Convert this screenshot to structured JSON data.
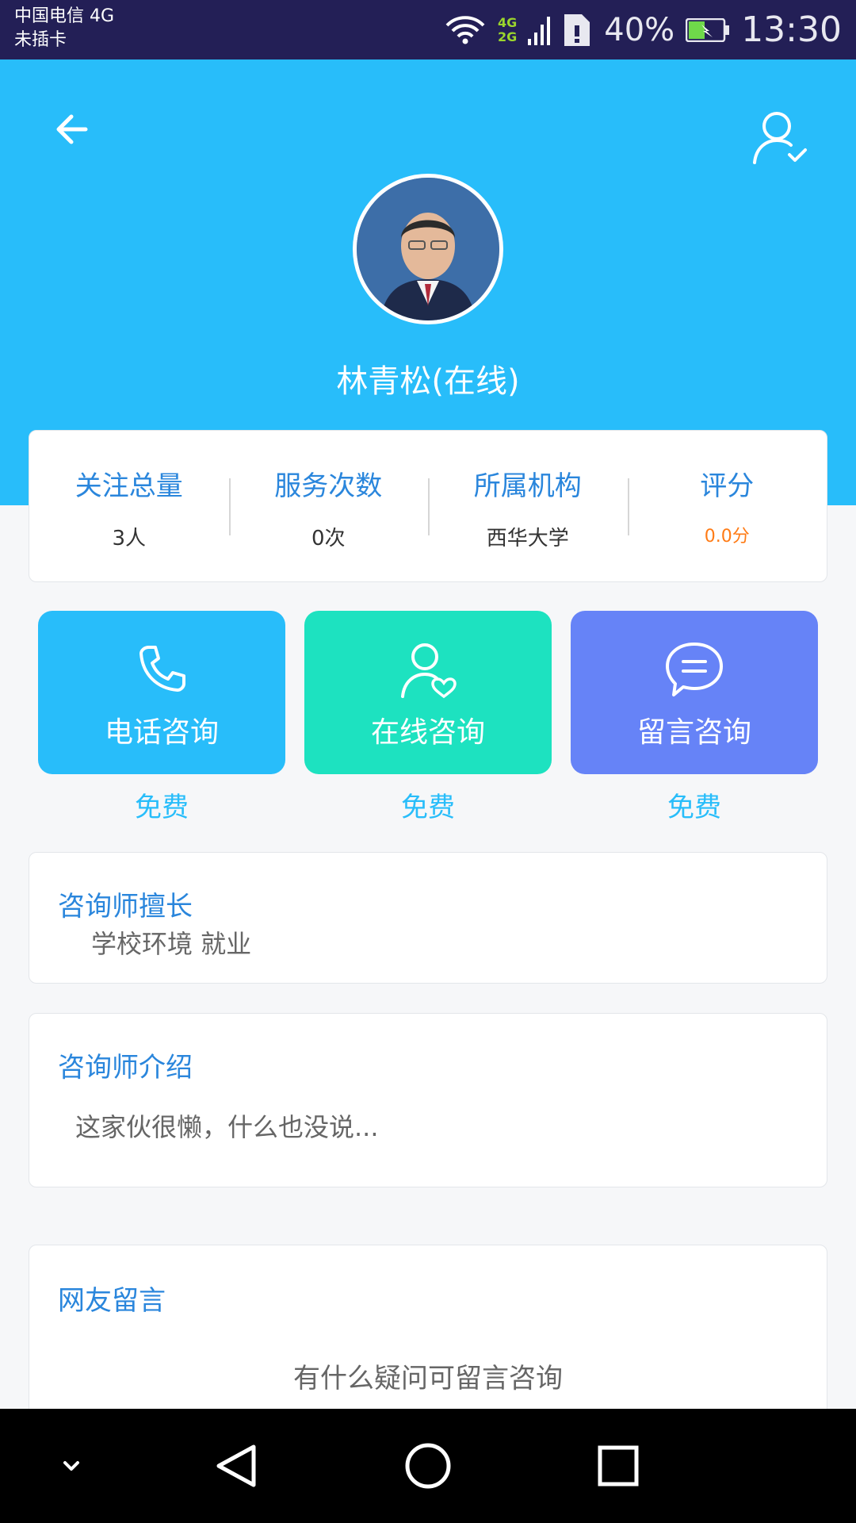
{
  "status_bar": {
    "carrier_line1": "中国电信 4G",
    "carrier_line2": "未插卡",
    "net_4g": "4G",
    "net_2g": "2G",
    "battery": "40%",
    "time": "13:30"
  },
  "header": {
    "back_icon": "back-arrow-icon",
    "profile_icon": "user-check-icon",
    "name": "林青松(在线)",
    "bg_color": "#28bdfa"
  },
  "stats": [
    {
      "label": "关注总量",
      "value": "3人"
    },
    {
      "label": "服务次数",
      "value": "0次"
    },
    {
      "label": "所属机构",
      "value": "西华大学"
    },
    {
      "label": "评分",
      "value": "0.0分"
    }
  ],
  "actions": [
    {
      "label": "电话咨询",
      "price": "免费",
      "icon": "phone-icon",
      "color": "#28bdfa"
    },
    {
      "label": "在线咨询",
      "price": "免费",
      "icon": "user-heart-icon",
      "color": "#1de2c0"
    },
    {
      "label": "留言咨询",
      "price": "免费",
      "icon": "chat-bubble-icon",
      "color": "#6683f7"
    }
  ],
  "expertise": {
    "title": "咨询师擅长",
    "text": "学校环境 就业"
  },
  "intro": {
    "title": "咨询师介绍",
    "text": "这家伙很懒，什么也没说..."
  },
  "comments": {
    "title": "网友留言",
    "empty_text": "有什么疑问可留言咨询"
  },
  "nav_bar": {
    "icons": [
      "chevron-down-icon",
      "back-triangle-icon",
      "home-circle-icon",
      "recents-square-icon"
    ]
  }
}
